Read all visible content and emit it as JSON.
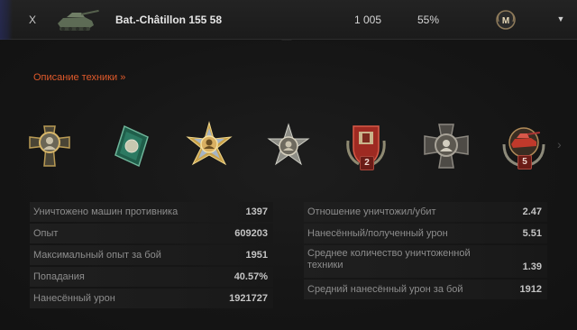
{
  "header": {
    "level": "X",
    "tank_name": "Bat.-Châtillon 155 58",
    "battles": "1 005",
    "winrate": "55%",
    "mastery_letter": "M",
    "dropdown_icon": "chevron-down-icon"
  },
  "details": {
    "description_link": "Описание техники »"
  },
  "medals": [
    {
      "name": "cross-medal-icon",
      "badge": ""
    },
    {
      "name": "green-badge-medal-icon",
      "badge": ""
    },
    {
      "name": "gold-star-medal-icon",
      "badge": ""
    },
    {
      "name": "silver-star-medal-icon",
      "badge": ""
    },
    {
      "name": "red-shield-medal-icon",
      "badge": "2"
    },
    {
      "name": "bronze-cross-medal-icon",
      "badge": ""
    },
    {
      "name": "tank-wreath-medal-icon",
      "badge": "5"
    }
  ],
  "stats_left": [
    {
      "label": "Уничтожено машин противника",
      "value": "1397"
    },
    {
      "label": "Опыт",
      "value": "609203"
    },
    {
      "label": "Максимальный опыт за бой",
      "value": "1951"
    },
    {
      "label": "Попадания",
      "value": "40.57%"
    },
    {
      "label": "Нанесённый урон",
      "value": "1921727"
    }
  ],
  "stats_right": [
    {
      "label": "Отношение уничтожил/убит",
      "value": "2.47"
    },
    {
      "label": "Нанесённый/полученный урон",
      "value": "5.51"
    },
    {
      "label": "Среднее количество уничтоженной техники",
      "value": "1.39"
    },
    {
      "label": "Средний нанесённый урон за бой",
      "value": "1912"
    }
  ],
  "colors": {
    "accent_link": "#e05a2b",
    "badge_red": "#6b1c17"
  }
}
